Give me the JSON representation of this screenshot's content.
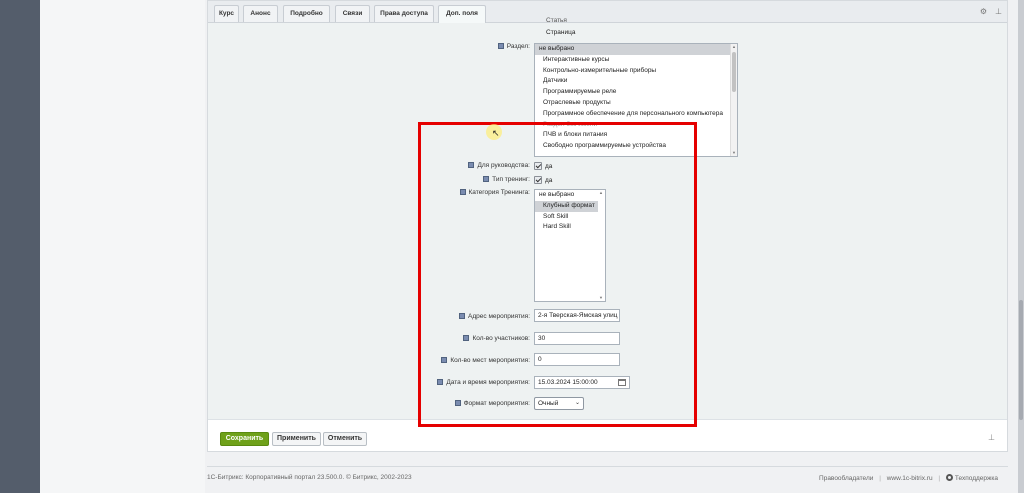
{
  "tabs": [
    {
      "label": "Курс"
    },
    {
      "label": "Анонс"
    },
    {
      "label": "Подробно"
    },
    {
      "label": "Связи"
    },
    {
      "label": "Права доступа"
    },
    {
      "label": "Доп. поля"
    }
  ],
  "prev_items": [
    {
      "label": "Статья"
    },
    {
      "label": "Страница"
    }
  ],
  "razdel": {
    "label": "Раздел:",
    "options": [
      {
        "label": "не выбрано"
      },
      {
        "label": "Интерактивные курсы"
      },
      {
        "label": "Контрольно-измерительные приборы"
      },
      {
        "label": "Датчики"
      },
      {
        "label": "Программируемые реле"
      },
      {
        "label": "Отраслевые продукты"
      },
      {
        "label": "Программное обеспечение для персонального компьютера"
      },
      {
        "label": "Раздел без имени"
      },
      {
        "label": "ПЧВ и блоки питания"
      },
      {
        "label": "Свободно программируемые устройства"
      }
    ]
  },
  "rukovodstvo": {
    "label": "Для руководства:",
    "value": "да"
  },
  "tip_trening": {
    "label": "Тип тренинг:",
    "value": "да"
  },
  "kategoriya": {
    "label": "Категория Тренинга:",
    "options": [
      {
        "label": "не выбрано"
      },
      {
        "label": "Клубный формат"
      },
      {
        "label": "Soft Skill"
      },
      {
        "label": "Hard Skill"
      }
    ]
  },
  "adres": {
    "label": "Адрес мероприятия:",
    "value": "2-я Тверская-Ямская улиц"
  },
  "kol_uchastnikov": {
    "label": "Кол-во участников:",
    "value": "30"
  },
  "kol_mest": {
    "label": "Кол-во мест мероприятия:",
    "value": "0"
  },
  "data_vremya": {
    "label": "Дата и время мероприятия:",
    "value": "15.03.2024 15:00:00"
  },
  "format": {
    "label": "Формат мероприятия:",
    "value": "Очный"
  },
  "buttons": {
    "save": "Сохранить",
    "apply": "Применить",
    "cancel": "Отменить"
  },
  "footer": {
    "copyright": "1С-Битрикс: Корпоративный портал 23.500.0. © Битрикс, 2002-2023",
    "right_holders": "Правообладатели",
    "site": "www.1c-bitrix.ru",
    "support": "Техподдержка"
  },
  "colors": {
    "accent_green": "#6fa11a",
    "highlight_red": "#e50000"
  }
}
